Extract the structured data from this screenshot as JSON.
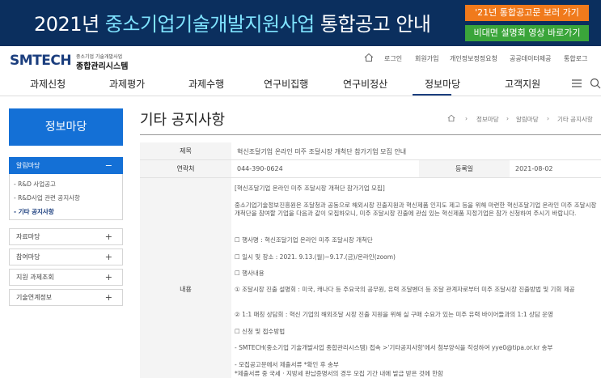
{
  "banner": {
    "title_prefix": "2021년 ",
    "title_accent": "중소기업기술개발지원사업",
    "title_suffix": " 통합공고 안내",
    "btn_notice": "'21년 통합공고문 보러 가기",
    "btn_video": "비대면 설명회 영상 바로가기"
  },
  "header": {
    "logo": "SMTECH",
    "logo_sub1": "중소기업 기술개발사업",
    "logo_sub2": "종합관리시스템",
    "util": [
      "로그인",
      "회원가입",
      "개인정보정정요청",
      "공공데이터제공",
      "통합로그"
    ]
  },
  "nav": [
    "과제신청",
    "과제평가",
    "과제수행",
    "연구비집행",
    "연구비정산",
    "정보마당",
    "고객지원"
  ],
  "sidebar": {
    "title": "정보마당",
    "sections": [
      {
        "label": "알림마당",
        "toggle": "−"
      },
      {
        "label": "자료마당",
        "toggle": "+"
      },
      {
        "label": "참여마당",
        "toggle": "+"
      },
      {
        "label": "지원 과제조회",
        "toggle": "+"
      },
      {
        "label": "기술연계정보",
        "toggle": "+"
      }
    ],
    "subitems": [
      "- R&D 사업공고",
      "- R&D사업 관련 공지사항",
      "- 기타 공지사항"
    ]
  },
  "content": {
    "page_title": "기타 공지사항",
    "breadcrumb": [
      "정보마당",
      "알림마당",
      "기타 공지사항"
    ],
    "breadcrumb_sep": "›",
    "labels": {
      "subject": "제목",
      "contact": "연락처",
      "reg_date": "등록일",
      "content": "내용"
    },
    "subject": "혁신조달기업 온라인 미주 조달시장 개척단 참가기업 모집 안내",
    "contact": "044-390-0624",
    "reg_date": "2021-08-02",
    "body": [
      "[혁신조달기업 온라인 미주 조달시장 개척단 참가기업 모집]",
      "중소기업기술정보진흥원은 조달청과 공동으로 해외시장 진출지원과 혁신제품 인지도 제고 등을 위해 마련한 혁신조달기업 온라인 미주 조달시장 개척단을 참여할 기업을 다음과 같이 모집하오니, 미주 조달시장 진출에 관심 있는 혁신제품 지정기업은 참가 신청하여 주시기 바랍니다.",
      "☐ 행사명 : 혁신조달기업 온라인 미주 조달시장 개척단",
      "☐ 일시 및 장소 : 2021. 9.13.(월)~9.17.(금)/온라인(zoom)",
      "☐ 행사내용",
      "① 조달시장 진출 설명회 : 미국, 캐나다 등 주요국의 공무원, 유력 조달벤더 등 조달 관계자로부터 미주 조달시장 진출방법 및 기회 제공",
      "② 1:1 매칭 상담회 : 혁신 기업의 해외조달 시장 진출 지원을 위해 실 구매 수요가 있는 미주 유력 바이어들과의 1:1 상담 운영",
      "☐ 신청 및 접수방법",
      "- SMTECH(중소기업 기술개발사업 종합관리시스템) 접속 >'기타공지사항'에서 첨부양식을 작성하여 yye0@tipa.or.kr 송부",
      "- 모집공고문에서 제출서류 *확인 후 송부",
      "*제출서류 중 국세 · 지방세 완납증명서의 경우 모집 기간 내에 발급 받은 것에 한함"
    ]
  }
}
